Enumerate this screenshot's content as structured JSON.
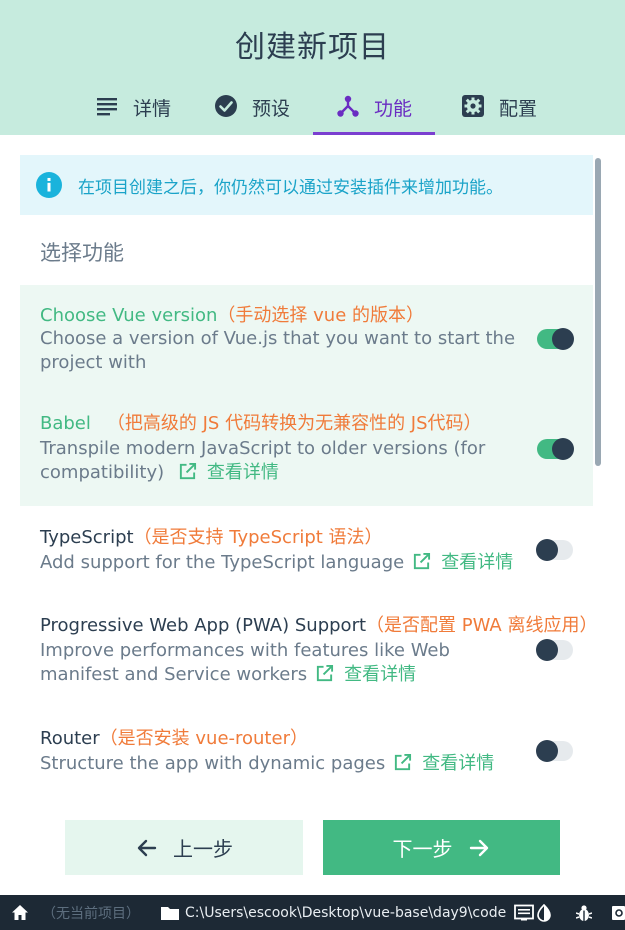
{
  "page_title": "创建新项目",
  "tabs": [
    {
      "label": "详情",
      "icon": "list-icon"
    },
    {
      "label": "预设",
      "icon": "check-circle-icon"
    },
    {
      "label": "功能",
      "icon": "feature-tree-icon",
      "active": true
    },
    {
      "label": "配置",
      "icon": "gear-icon"
    }
  ],
  "info": {
    "text": "在项目创建之后，你仍然可以通过安装插件来增加功能。",
    "icon": "info-icon"
  },
  "section_title": "选择功能",
  "features": [
    {
      "name": "Choose Vue version",
      "note": "（手动选择 vue 的版本）",
      "desc": "Choose a version of Vue.js that you want to start the project with",
      "more": "",
      "enabled": true
    },
    {
      "name": "Babel",
      "note": "（把高级的 JS 代码转换为无兼容性的 JS代码）",
      "desc": "Transpile modern JavaScript to older versions (for compatibility)",
      "more": "查看详情",
      "enabled": true
    },
    {
      "name": "TypeScript",
      "note": "（是否支持 TypeScript 语法）",
      "desc": "Add support for the TypeScript language",
      "more": "查看详情",
      "enabled": false
    },
    {
      "name": "Progressive Web App (PWA) Support",
      "note": "（是否配置 PWA 离线应用）",
      "desc": "Improve performances with features like Web manifest and Service workers",
      "more": "查看详情",
      "enabled": false
    },
    {
      "name": "Router",
      "note": "（是否安装 vue-router）",
      "desc": "Structure the app with dynamic pages",
      "more": "查看详情",
      "enabled": false
    }
  ],
  "buttons": {
    "prev": "上一步",
    "next": "下一步"
  },
  "statusbar": {
    "no_project": "（无当前项目）",
    "path": "C:\\Users\\escook\\Desktop\\vue-base\\day9\\code"
  },
  "colors": {
    "header_bg": "#c6ebde",
    "accent": "#42b983",
    "tab_active": "#7b3fd0",
    "note": "#f07b3a",
    "info": "#1aa3c8",
    "statusbar_bg": "#1d2935"
  }
}
